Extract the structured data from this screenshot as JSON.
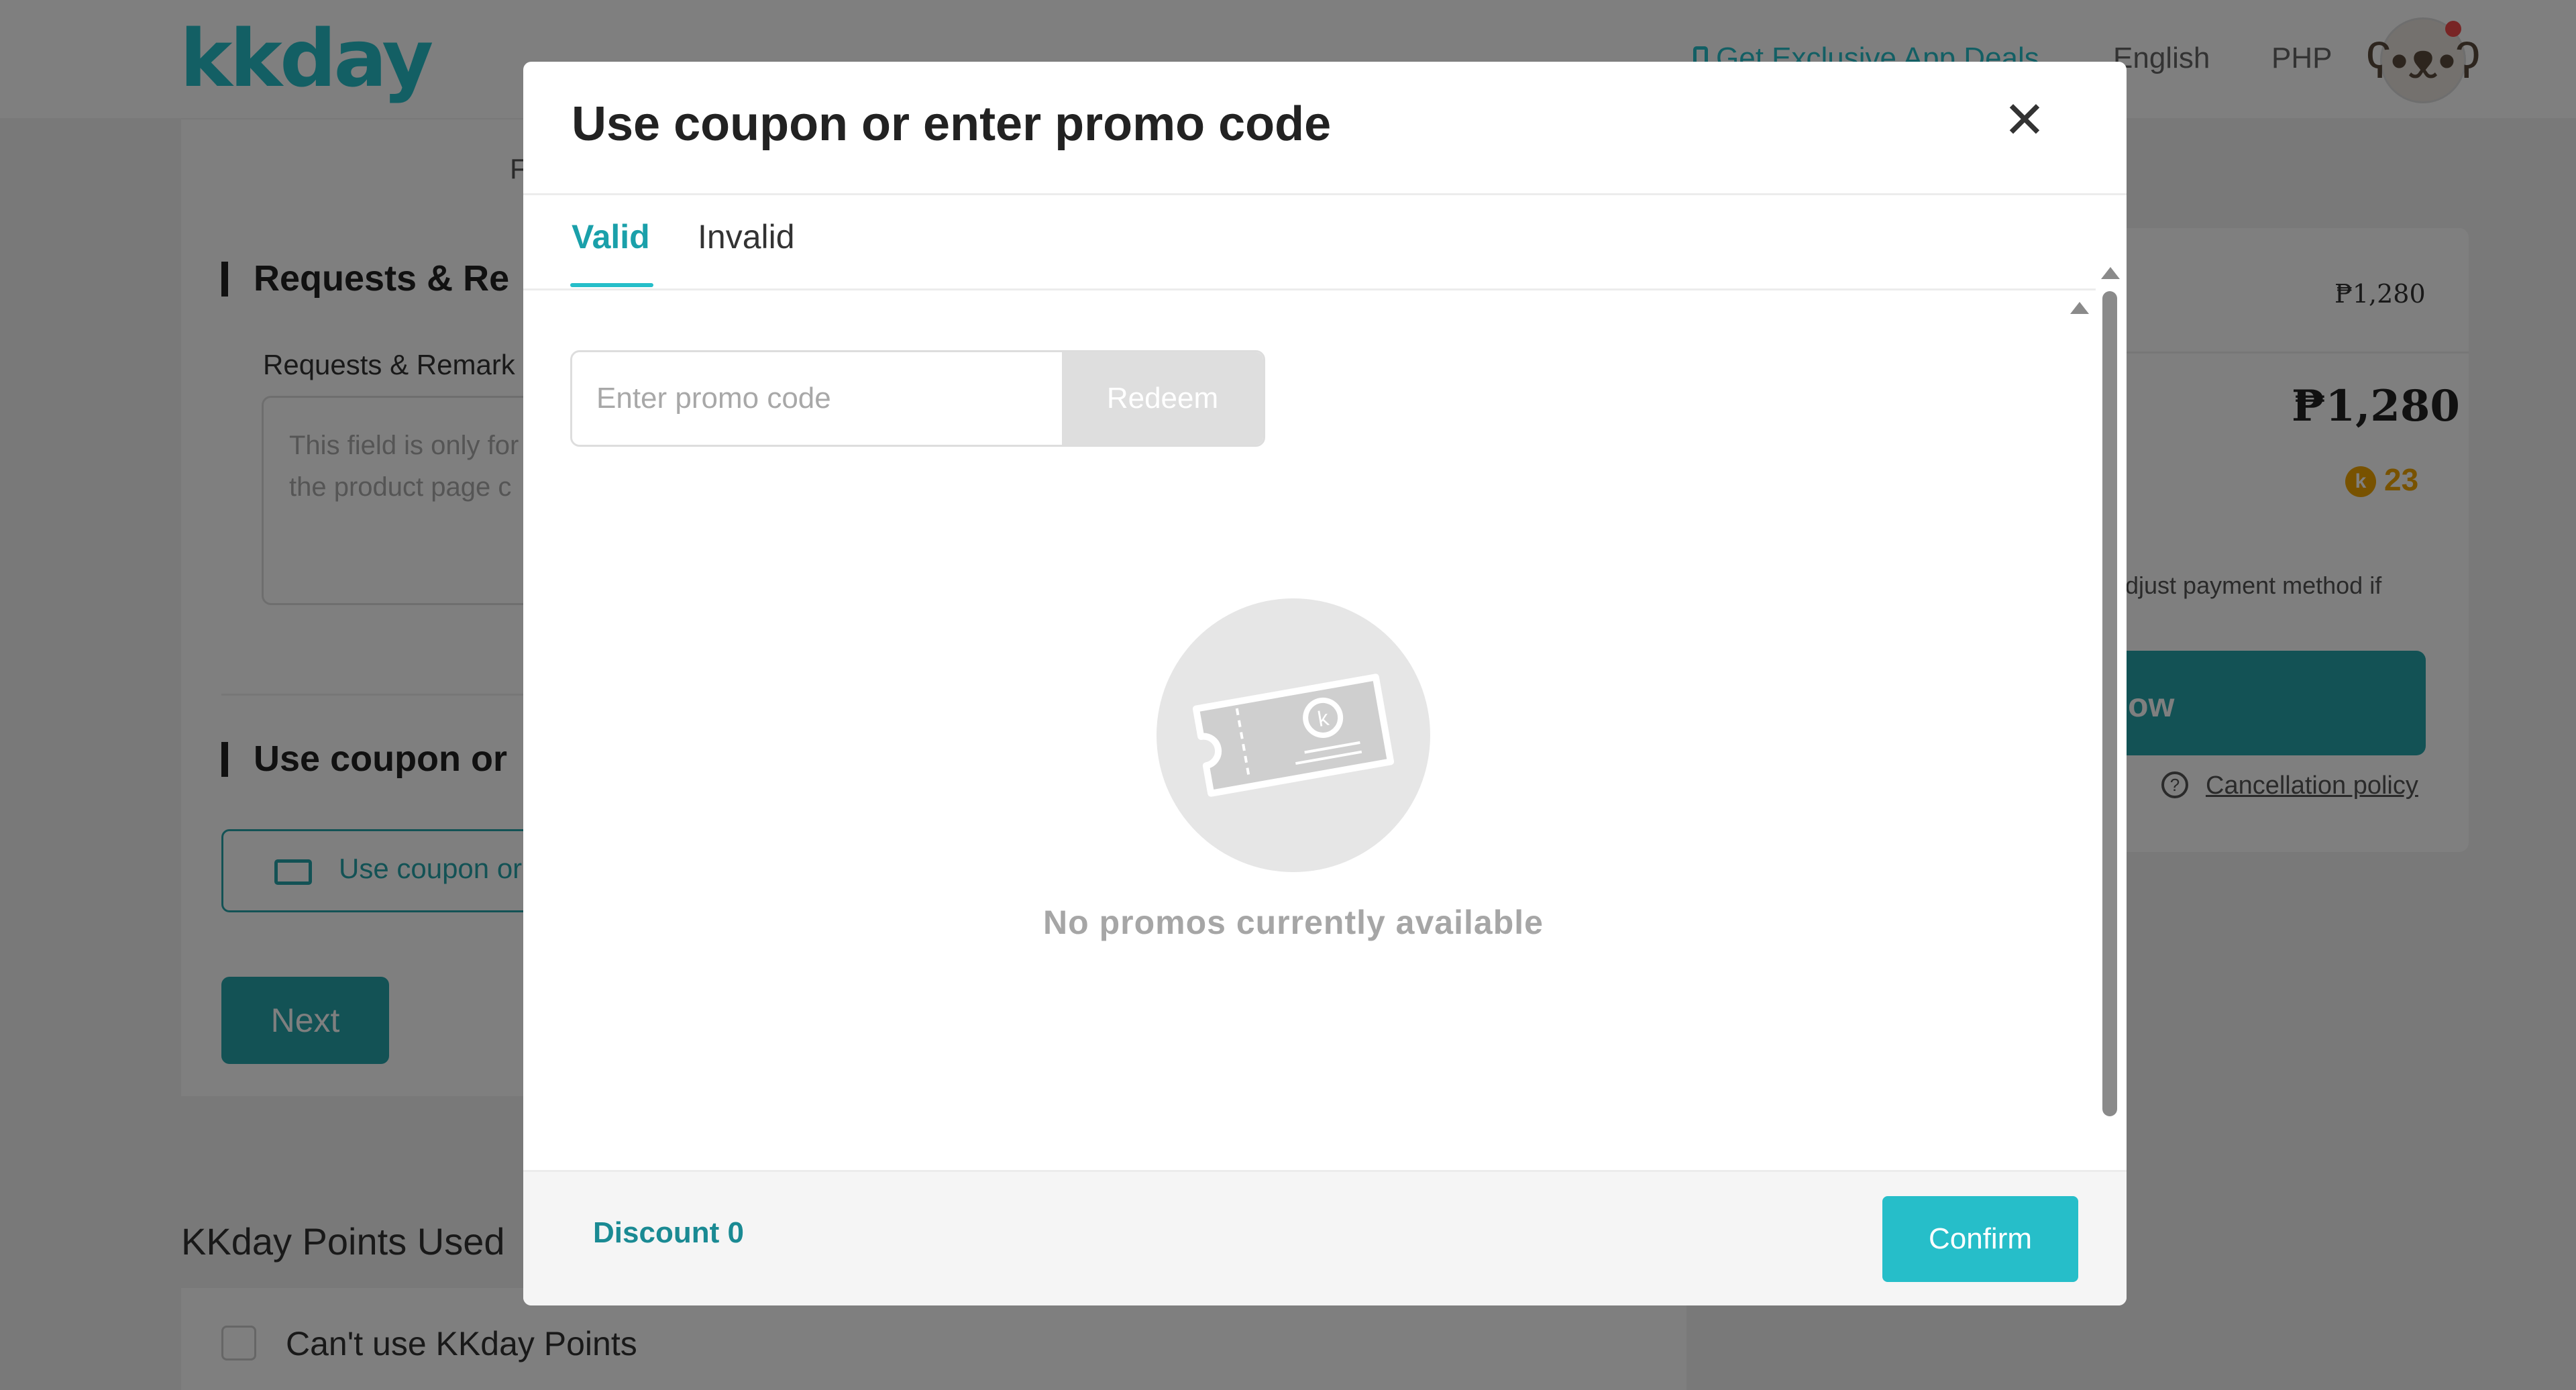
{
  "header": {
    "logo": "kkday",
    "app_deals": "Get Exclusive App Deals",
    "language": "English",
    "currency": "PHP"
  },
  "form": {
    "partial_label": "F",
    "requests_title": "Requests & Re",
    "requests_label": "Requests & Remark",
    "requests_placeholder_line1": "This field is only for",
    "requests_placeholder_line2": "the product page c",
    "coupon_title": "Use coupon or",
    "coupon_button": "Use coupon or",
    "next_button": "Next"
  },
  "points": {
    "title": "KKday Points Used",
    "checkbox_label": "Can't use KKday Points"
  },
  "summary": {
    "price_small": "₱1,280",
    "price_total": "₱1,280",
    "points_badge": "k",
    "points_earned": "23",
    "payment_note": "djust payment method if",
    "pay_button": "ow",
    "cancellation": "Cancellation policy"
  },
  "modal": {
    "title": "Use coupon or enter promo code",
    "close": "✕",
    "tabs": [
      "Valid",
      "Invalid"
    ],
    "promo_placeholder": "Enter promo code",
    "redeem": "Redeem",
    "empty_message": "No promos currently available",
    "empty_icon_letter": "k",
    "discount_label": "Discount 0",
    "confirm": "Confirm"
  },
  "colors": {
    "brand": "#26bec9",
    "brand_dark": "#26a5ab",
    "points": "#f0a500"
  }
}
